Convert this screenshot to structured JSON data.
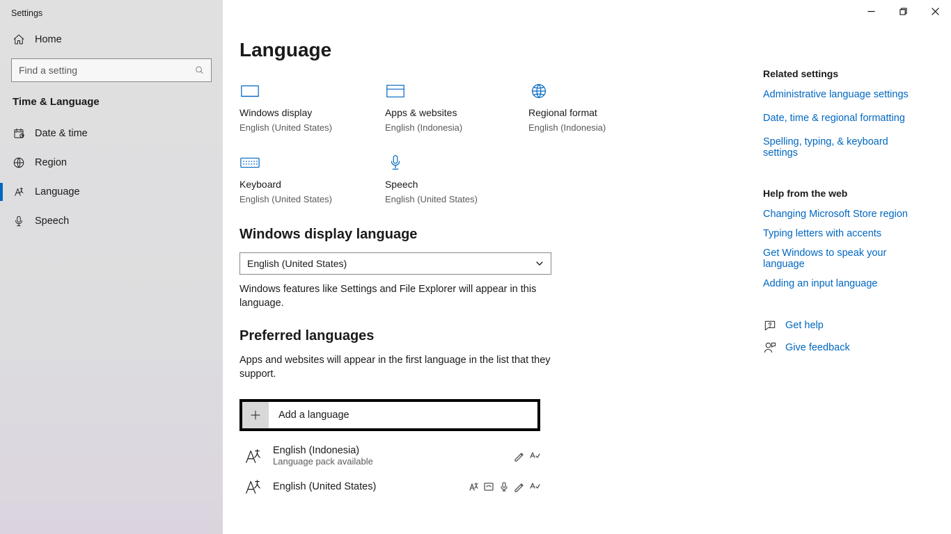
{
  "app": {
    "title": "Settings"
  },
  "sidebar": {
    "home_label": "Home",
    "search_placeholder": "Find a setting",
    "section": "Time & Language",
    "items": [
      {
        "id": "datetime",
        "label": "Date & time"
      },
      {
        "id": "region",
        "label": "Region"
      },
      {
        "id": "language",
        "label": "Language"
      },
      {
        "id": "speech",
        "label": "Speech"
      }
    ],
    "active": "language"
  },
  "page": {
    "title": "Language",
    "cards": [
      {
        "id": "display",
        "label": "Windows display",
        "value": "English (United States)"
      },
      {
        "id": "apps",
        "label": "Apps & websites",
        "value": "English (Indonesia)"
      },
      {
        "id": "region",
        "label": "Regional format",
        "value": "English (Indonesia)"
      },
      {
        "id": "keyboard",
        "label": "Keyboard",
        "value": "English (United States)"
      },
      {
        "id": "speech",
        "label": "Speech",
        "value": "English (United States)"
      }
    ],
    "display_section": {
      "heading": "Windows display language",
      "selected": "English (United States)",
      "note": "Windows features like Settings and File Explorer will appear in this language."
    },
    "pref_section": {
      "heading": "Preferred languages",
      "note": "Apps and websites will appear in the first language in the list that they support.",
      "add_label": "Add a language",
      "items": [
        {
          "name": "English (Indonesia)",
          "sub": "Language pack available",
          "feat": [
            "handwrite",
            "abc"
          ]
        },
        {
          "name": "English (United States)",
          "sub": "",
          "feat": [
            "az",
            "box",
            "mic",
            "handwrite",
            "abc"
          ]
        }
      ]
    }
  },
  "related": {
    "heading": "Related settings",
    "links": [
      "Administrative language settings",
      "Date, time & regional formatting",
      "Spelling, typing, & keyboard settings"
    ]
  },
  "help": {
    "heading": "Help from the web",
    "links": [
      "Changing Microsoft Store region",
      "Typing letters with accents",
      "Get Windows to speak your language",
      "Adding an input language"
    ]
  },
  "support": {
    "get_help": "Get help",
    "feedback": "Give feedback"
  }
}
